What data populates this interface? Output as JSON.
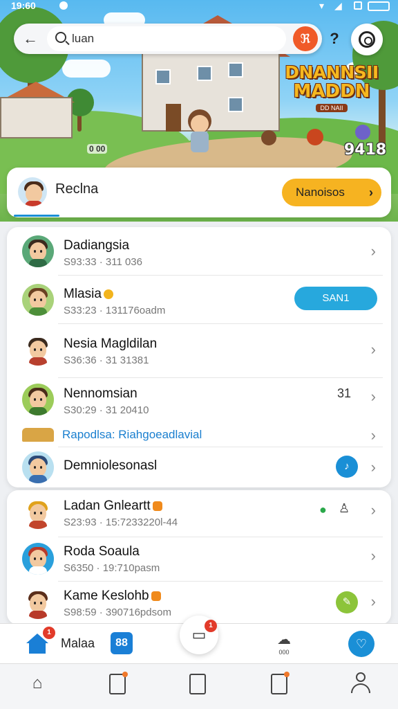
{
  "status_bar": {
    "time": "19:60"
  },
  "search": {
    "value": "luan",
    "placeholder": ""
  },
  "hero": {
    "logo_line1": "DNANNSII",
    "logo_line2": "MADDN",
    "logo_sub": "DD NAII",
    "score": "9418",
    "mini_label": "0 00"
  },
  "profile": {
    "name": "Reclna",
    "action_label": "Nanoisos"
  },
  "list_one": [
    {
      "title": "Dadiangsia",
      "subtitle": "S93:33 · 311 036",
      "trailing": "chevron"
    },
    {
      "title": "Mlasia",
      "subtitle": "S33:23 · 131176oadm",
      "badge": "yellow",
      "trailing": "button",
      "button_label": "SAN1"
    },
    {
      "title": "Nesia Magldilan",
      "subtitle": "S36:36 · 31 31381",
      "trailing": "chevron"
    },
    {
      "title": "Nennomsian",
      "subtitle": "S30:29 · 31 20410",
      "trailing": "count",
      "count": "31"
    },
    {
      "link_text": "Rapodlsa: Riahgoeadlavial",
      "trailing": "chevron"
    },
    {
      "title": "Demniolesonasl",
      "trailing": "music-icon"
    }
  ],
  "list_two": [
    {
      "title": "Ladan Gnleartt",
      "subtitle": "S23:93 · 15:7233220l-44",
      "badge": "orange",
      "trailing": "icons"
    },
    {
      "title": "Roda Soaula",
      "subtitle": "S6350 · 19:710pasm",
      "trailing": "chevron"
    },
    {
      "title": "Kame Keslohb",
      "subtitle": "S98:59 · 390716pdsom",
      "badge": "orange",
      "trailing": "leaf-icon"
    }
  ],
  "action_bar": {
    "home_badge": "1",
    "label": "Malaa",
    "grid_icon": "88",
    "chat_badge": "1",
    "cloud_label": "000"
  },
  "colors": {
    "accent_blue": "#1a7fd6",
    "accent_orange": "#f05a28",
    "accent_yellow": "#f6b321",
    "pill_blue": "#27a8dd",
    "link_blue": "#1a7fcf"
  }
}
